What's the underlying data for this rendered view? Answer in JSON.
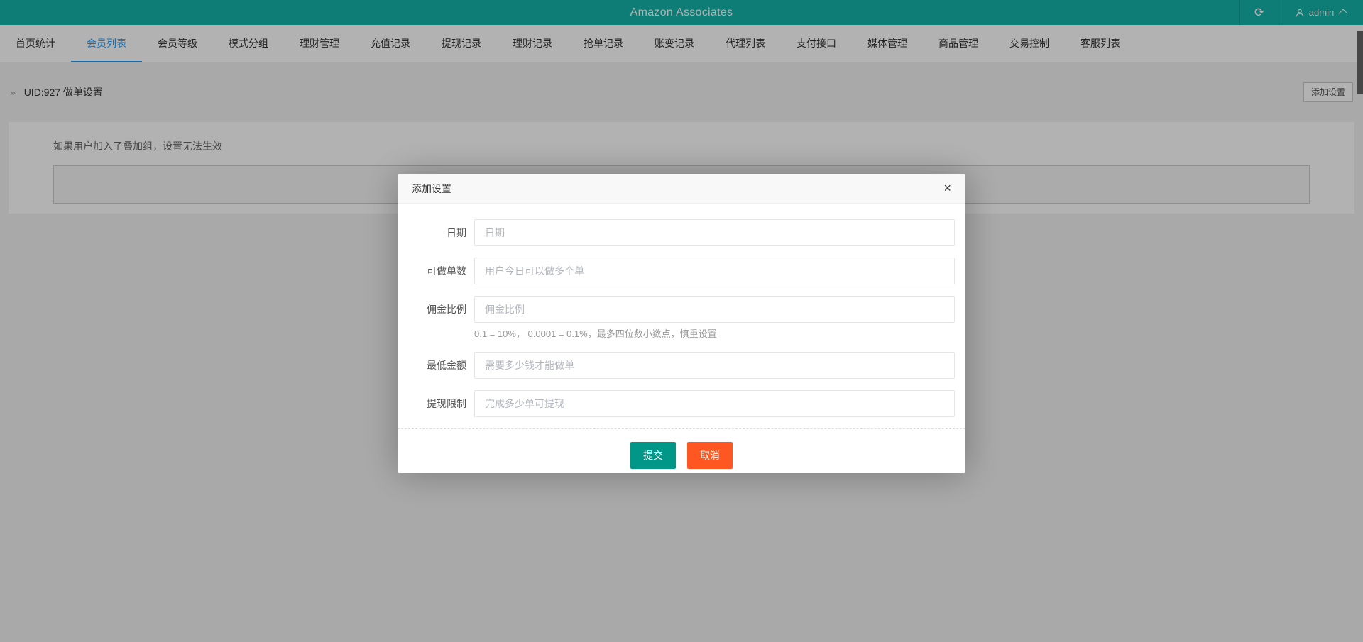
{
  "colors": {
    "header_bg": "#14b3aa",
    "active_tab": "#1E9FFF",
    "submit_bg": "#009688",
    "cancel_bg": "#FF5722"
  },
  "header": {
    "title": "Amazon Associates",
    "user": "admin",
    "refresh_icon": "refresh-circular-arrow",
    "user_icon": "person-outline",
    "chevron_icon": "chevron-up"
  },
  "nav": {
    "active_index": 1,
    "items": [
      "首页统计",
      "会员列表",
      "会员等级",
      "模式分组",
      "理财管理",
      "充值记录",
      "提现记录",
      "理财记录",
      "抢单记录",
      "账变记录",
      "代理列表",
      "支付接口",
      "媒体管理",
      "商品管理",
      "交易控制",
      "客服列表"
    ]
  },
  "breadcrumb": {
    "arrow": "»",
    "text": "UID:927 做单设置",
    "add_button": "添加设置"
  },
  "content": {
    "note": "如果用户加入了叠加组，设置无法生效"
  },
  "modal": {
    "title": "添加设置",
    "close": "×",
    "fields": [
      {
        "label": "日期",
        "placeholder": "日期"
      },
      {
        "label": "可做单数",
        "placeholder": "用户今日可以做多个单"
      },
      {
        "label": "佣金比例",
        "placeholder": "佣金比例",
        "help": "0.1 = 10%， 0.0001 = 0.1%，最多四位数小数点，慎重设置"
      },
      {
        "label": "最低金额",
        "placeholder": "需要多少钱才能做单"
      },
      {
        "label": "提现限制",
        "placeholder": "完成多少单可提现"
      }
    ],
    "submit_label": "提交",
    "cancel_label": "取消"
  }
}
